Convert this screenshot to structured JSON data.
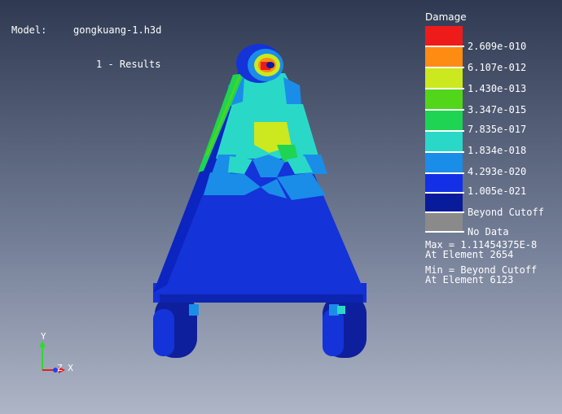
{
  "header": {
    "model_label": "Model:",
    "model_file": "gongkuang-1.h3d",
    "subcase": "1 - Results"
  },
  "legend": {
    "title": "Damage",
    "items": [
      {
        "color": "#ee1b1b",
        "label": "2.609e-010"
      },
      {
        "color": "#ff8c12",
        "label": "6.107e-012"
      },
      {
        "color": "#cce81e",
        "label": "1.430e-013"
      },
      {
        "color": "#52d61a",
        "label": "3.347e-015"
      },
      {
        "color": "#1ed452",
        "label": "7.835e-017"
      },
      {
        "color": "#2ad8c8",
        "label": "1.834e-018"
      },
      {
        "color": "#1a8de8",
        "label": "4.293e-020"
      },
      {
        "color": "#1430e6",
        "label": "1.005e-021"
      },
      {
        "color": "#081b9a",
        "label": "Beyond Cutoff"
      },
      {
        "color": "#8a8a8a",
        "label": "No Data"
      }
    ],
    "max_line1": "Max = 1.11454375E-8",
    "max_line2": "At Element 2654",
    "min_line1": "Min = Beyond Cutoff",
    "min_line2": "At Element 6123"
  },
  "axes": {
    "y_label": "Y",
    "zx_label": "Z X",
    "y_color": "#2bdc2b",
    "x_color": "#e02020",
    "z_color": "#2040ff"
  }
}
